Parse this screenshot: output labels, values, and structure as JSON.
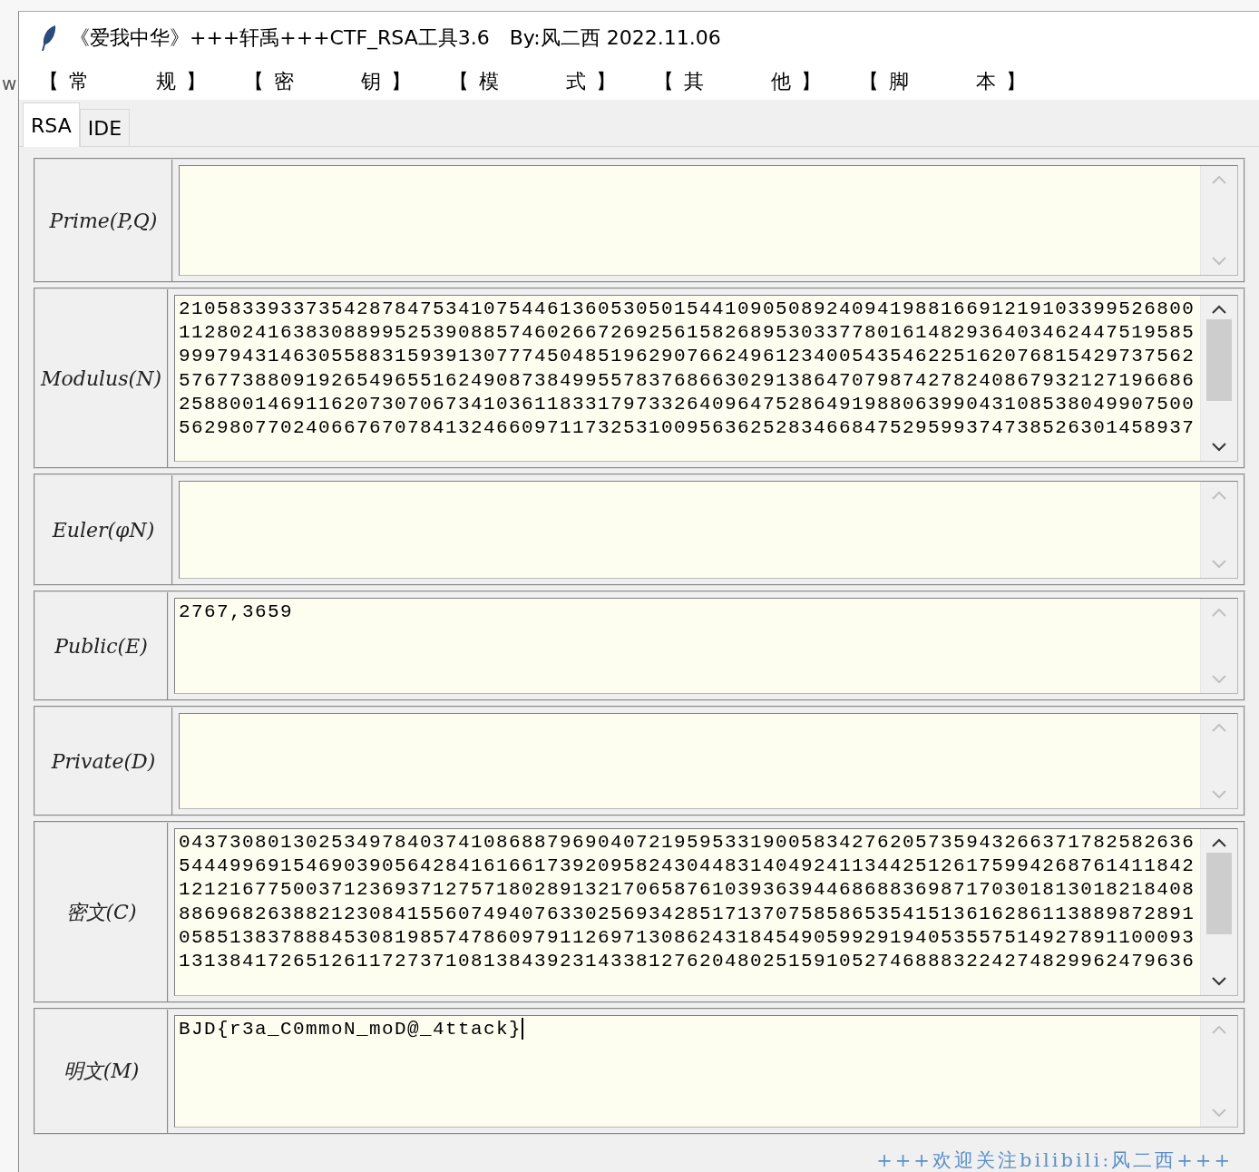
{
  "browser": {
    "side_fragments": [
      "w"
    ]
  },
  "window": {
    "title": "《爱我中华》+++轩禹+++CTF_RSA工具3.6　By:风二西 2022.11.06"
  },
  "menu": [
    {
      "open": "【",
      "label": "常　　　规",
      "close": "】"
    },
    {
      "open": "【",
      "label": "密　　　钥",
      "close": "】"
    },
    {
      "open": "【",
      "label": "模　　　式",
      "close": "】"
    },
    {
      "open": "【",
      "label": "其　　　他",
      "close": "】"
    },
    {
      "open": "【",
      "label": "脚　　　本",
      "close": "】"
    }
  ],
  "tabs": [
    {
      "label": "RSA",
      "selected": true
    },
    {
      "label": "IDE",
      "selected": false
    }
  ],
  "fields": [
    {
      "label": "Prime(P,Q)"
    },
    {
      "label": "Modulus(N)",
      "value": "210583393373542878475341075446136053050154410905089240941988166912191033995268001128024163830889952539088574602667269256158268953033778016148293640346244751958599979431463055883159391307774504851962907662496123400543546225162076815429737562576773880919265496551624908738499557837686630291386470798742782408679321271966862588001469116207307067341036118331797332640964752864919880639904310853804990750056298077024066767078413246609711732531009563625283466847529599374738526301458937"
    },
    {
      "label": "Euler(φN)"
    },
    {
      "label": "Public(E)",
      "value": "2767,3659"
    },
    {
      "label": "Private(D)"
    },
    {
      "label": "密文(C)",
      "value": "043730801302534978403741086887969040721959533190058342762057359432663717825826365444996915469039056428416166173920958243044831404924113442512617599426876141184212121677500371236937127571802891321706587610393639446868836987170301813018218408886968263882123084155607494076330256934285171370758586535415136162861138898728910585138378884530819857478609791126971308624318454905992919405355751492789110009313138417265126117273710813843923143381276204802515910527468883224274829962479636"
    },
    {
      "label": "明文(M)",
      "value": "BJD{r3a_C0mmoN_moD@_4ttack}",
      "focused": true
    }
  ],
  "footer": "+++欢迎关注bilibili:风二西+++"
}
